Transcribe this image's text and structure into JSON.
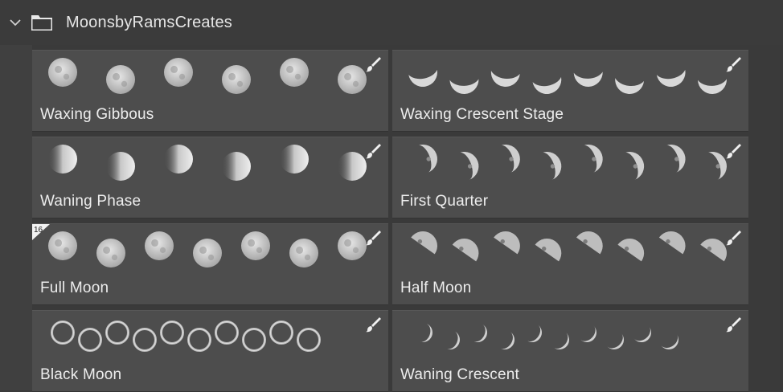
{
  "header": {
    "title": "MoonsbyRamsCreates",
    "icons": [
      "chevron-down-icon",
      "folder-icon"
    ]
  },
  "tiles": [
    {
      "label": "Waxing Gibbous",
      "style": "gibbous",
      "count": 6
    },
    {
      "label": "Waxing Crescent Stage",
      "style": "crescent",
      "count": 8
    },
    {
      "label": "Waning Phase",
      "style": "waning",
      "count": 6
    },
    {
      "label": "First Quarter",
      "style": "quarter",
      "count": 8
    },
    {
      "label": "Full Moon",
      "style": "full",
      "count": 7,
      "badge": "16"
    },
    {
      "label": "Half Moon",
      "style": "half",
      "count": 8
    },
    {
      "label": "Black Moon",
      "style": "ring",
      "count": 10
    },
    {
      "label": "Waning Crescent",
      "style": "thin",
      "count": 10
    }
  ],
  "colors": {
    "panel": "#3a3a3a",
    "tile": "#4d4d4d",
    "text": "#ededed"
  }
}
